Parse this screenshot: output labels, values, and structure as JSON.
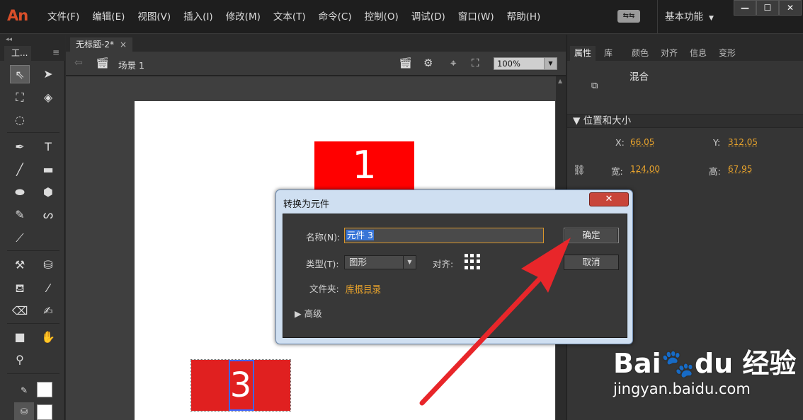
{
  "app": {
    "logo": "An",
    "menu": [
      "文件(F)",
      "编辑(E)",
      "视图(V)",
      "插入(I)",
      "修改(M)",
      "文本(T)",
      "命令(C)",
      "控制(O)",
      "调试(D)",
      "窗口(W)",
      "帮助(H)"
    ],
    "sync_label": "⇆⇆",
    "workspace": "基本功能"
  },
  "tools_panel": {
    "tab": "工..."
  },
  "document": {
    "tab_title": "无标题-2*",
    "tab_close": "×",
    "scene": "场景 1",
    "zoom": "100%",
    "symbol1_text": "1",
    "symbol3_text": "3"
  },
  "properties": {
    "tabs": [
      "属性",
      "库",
      "颜色",
      "对齐",
      "信息",
      "变形"
    ],
    "blend_label": "混合",
    "section": "▼ 位置和大小",
    "x_label": "X:",
    "x_value": "66.05",
    "y_label": "Y:",
    "y_value": "312.05",
    "w_label": "宽:",
    "w_value": "124.00",
    "h_label": "高:",
    "h_value": "67.95"
  },
  "dialog": {
    "title": "转换为元件",
    "name_label": "名称(N):",
    "name_value": "元件 3",
    "type_label": "类型(T):",
    "type_value": "图形",
    "align_label": "对齐:",
    "folder_label": "文件夹:",
    "folder_value": "库根目录",
    "advanced_label": "▶  高级",
    "ok_label": "确定",
    "cancel_label": "取消",
    "close_label": "✕"
  },
  "annotation": {
    "arrow_color": "#e8262a"
  },
  "watermark": {
    "brand": "Bai🐾du 经验",
    "url": "jingyan.baidu.com"
  }
}
